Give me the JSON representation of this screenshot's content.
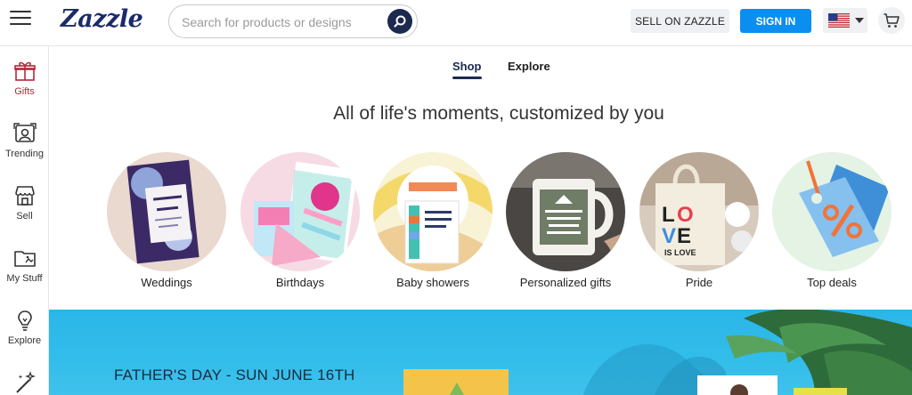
{
  "header": {
    "logo": "Zazzle",
    "search_placeholder": "Search for products or designs",
    "sell_label": "SELL ON ZAZZLE",
    "signin_label": "SIGN IN"
  },
  "sidebar": {
    "items": [
      {
        "label": "Gifts",
        "icon": "gift-icon"
      },
      {
        "label": "Trending",
        "icon": "trending-icon"
      },
      {
        "label": "Sell",
        "icon": "store-icon"
      },
      {
        "label": "My Stuff",
        "icon": "folder-icon"
      },
      {
        "label": "Explore",
        "icon": "lightbulb-icon"
      },
      {
        "label": "",
        "icon": "magic-wand-icon"
      }
    ]
  },
  "tabs": {
    "shop": "Shop",
    "explore": "Explore"
  },
  "headline": "All of life's moments, customized by you",
  "categories": [
    {
      "label": "Weddings"
    },
    {
      "label": "Birthdays"
    },
    {
      "label": "Baby showers"
    },
    {
      "label": "Personalized gifts"
    },
    {
      "label": "Pride"
    },
    {
      "label": "Top deals"
    }
  ],
  "banner": {
    "title": "FATHER'S DAY - SUN JUNE 16TH"
  },
  "colors": {
    "brand_navy": "#1b2a4e",
    "signin_blue": "#0a8ef0",
    "gifts_red": "#b5273a",
    "banner_blue": "#2ab6e8"
  }
}
